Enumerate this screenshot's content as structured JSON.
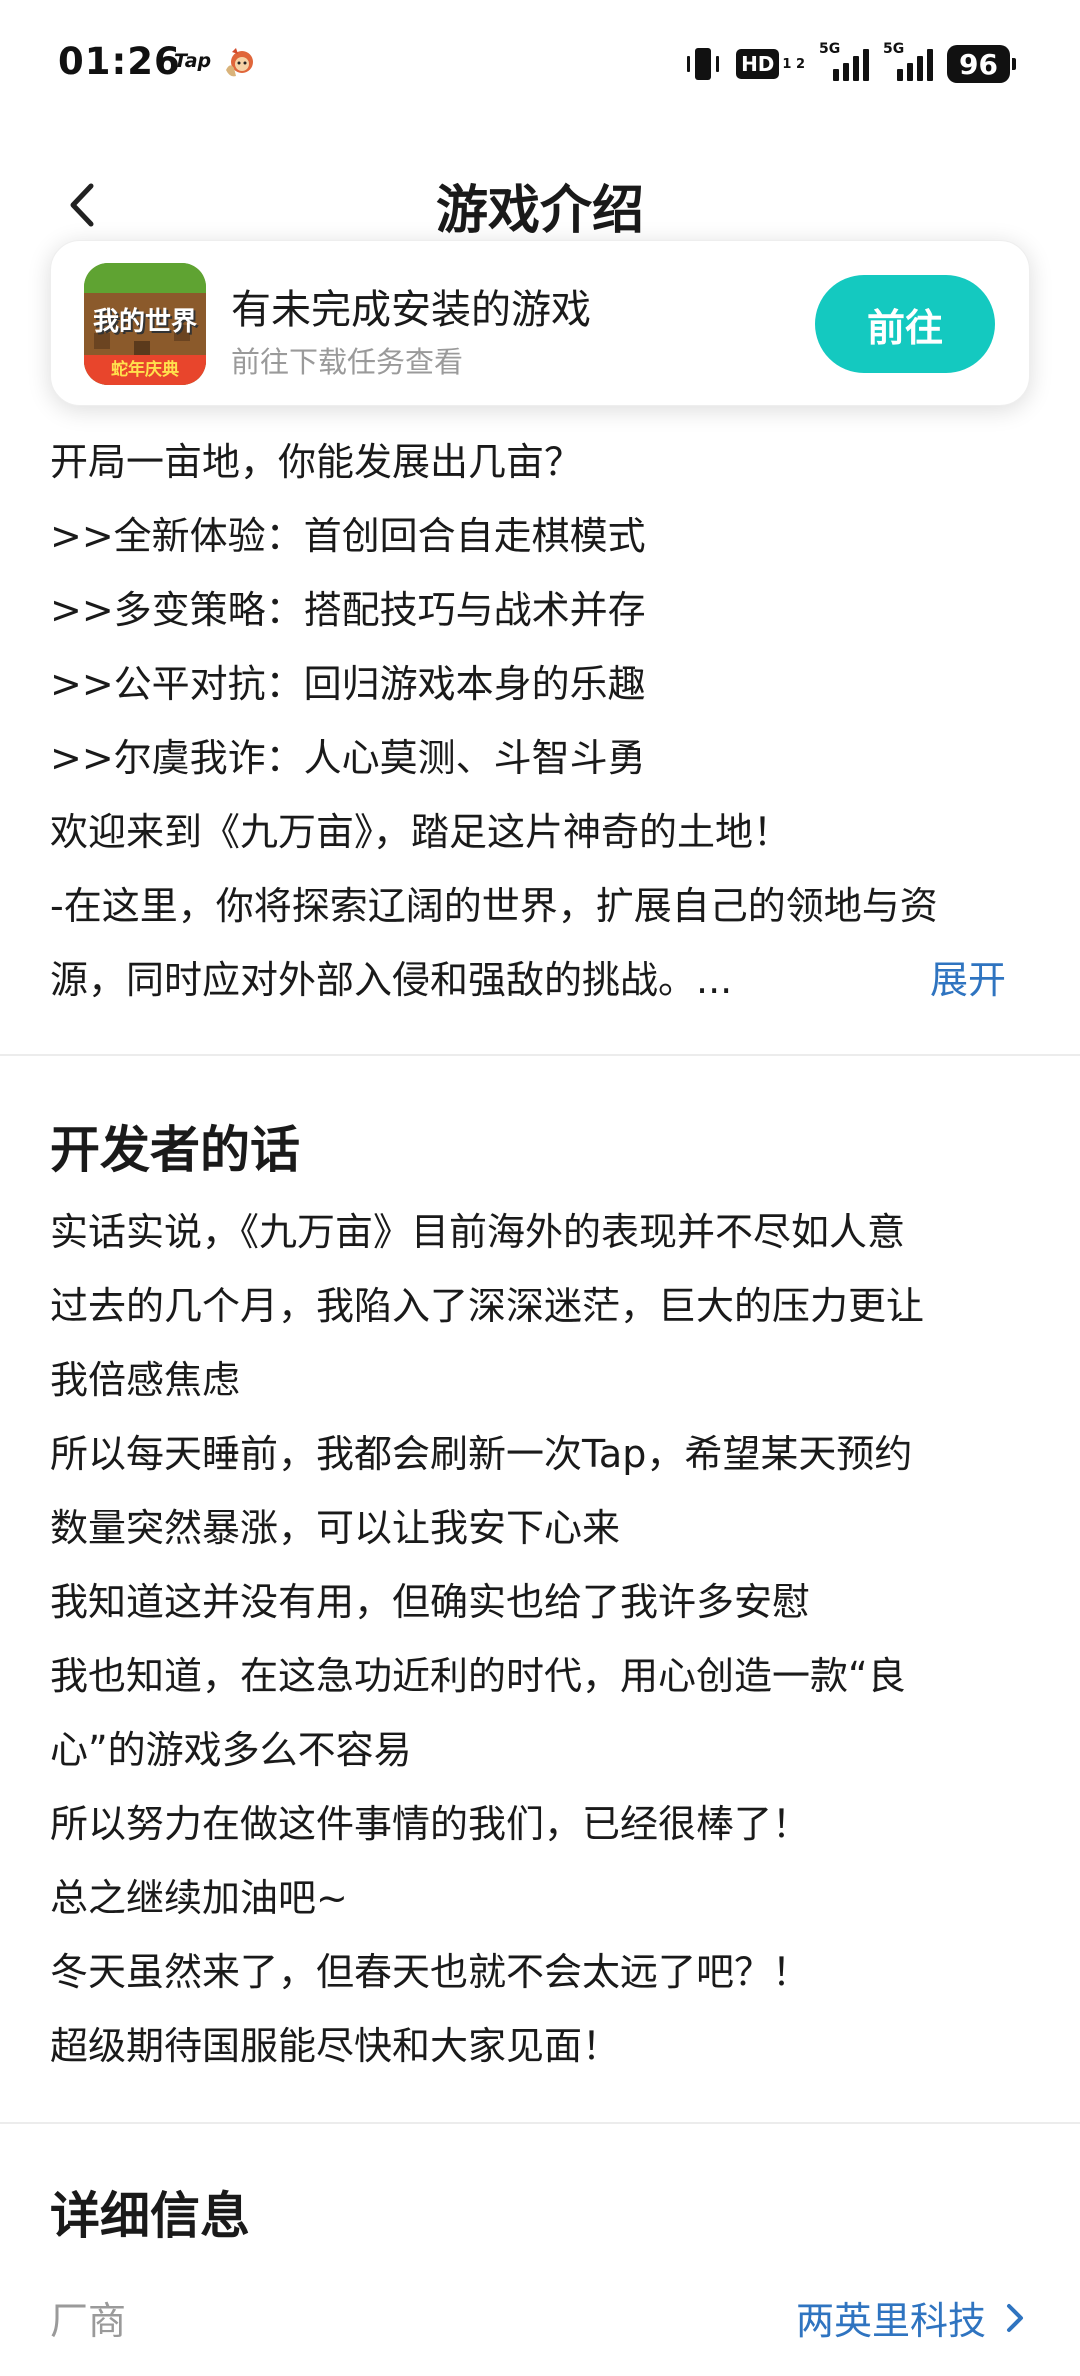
{
  "status": {
    "time": "01:26",
    "tap_label": "Tap",
    "hd_label": "HD",
    "hd_sub": "1 2",
    "sig1_label": "5G",
    "sig2_label": "5G",
    "battery": "96"
  },
  "header": {
    "title": "游戏介绍"
  },
  "banner": {
    "title": "有未完成安装的游戏",
    "subtitle": "前往下载任务查看",
    "button_label": "前往",
    "app_icon_text": "我的世界",
    "app_icon_ribbon": "蛇年庆典"
  },
  "intro": {
    "lines": [
      "开局一亩地，你能发展出几亩？",
      ">>全新体验：首创回合自走棋模式",
      ">>多变策略：搭配技巧与战术并存",
      ">>公平对抗：回归游戏本身的乐趣",
      ">>尔虞我诈：人心莫测、斗智斗勇",
      "欢迎来到《九万亩》，踏足这片神奇的土地！",
      "-在这里，你将探索辽阔的世界，扩展自己的领地与资",
      "源，同时应对外部入侵和强敌的挑战。..."
    ],
    "expand_label": "展开"
  },
  "developer": {
    "title": "开发者的话",
    "lines": [
      "实话实说，《九万亩》目前海外的表现并不尽如人意",
      "过去的几个月，我陷入了深深迷茫，巨大的压力更让",
      "我倍感焦虑",
      "所以每天睡前，我都会刷新一次Tap，希望某天预约",
      "数量突然暴涨，可以让我安下心来",
      "我知道这并没有用，但确实也给了我许多安慰",
      "我也知道，在这急功近利的时代，用心创造一款“良",
      "心”的游戏多么不容易",
      "所以努力在做这件事情的我们，已经很棒了！",
      "总之继续加油吧~",
      "冬天虽然来了，但春天也就不会太远了吧？！",
      "超级期待国服能尽快和大家见面！"
    ]
  },
  "details": {
    "title": "详细信息",
    "vendor_label": "厂商",
    "vendor_value": "两英里科技"
  },
  "colors": {
    "accent_button": "#14c9c0",
    "link": "#2f74c0"
  }
}
